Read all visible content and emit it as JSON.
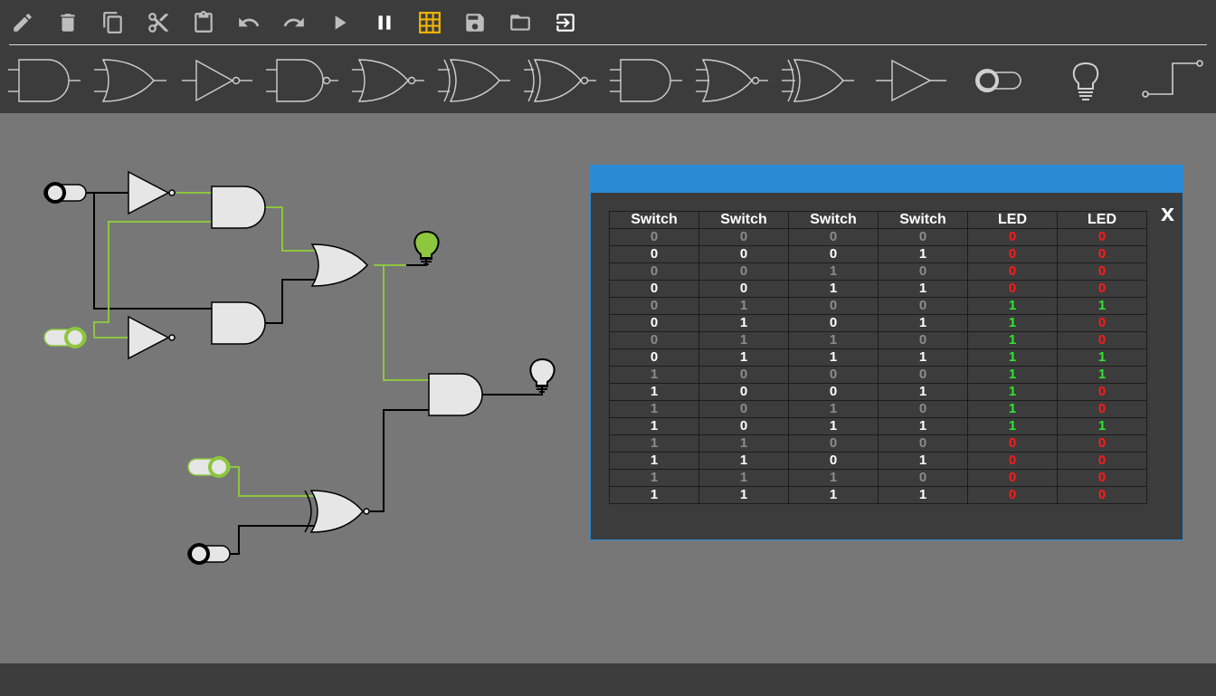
{
  "toolbar": {
    "tools": [
      {
        "name": "edit-icon",
        "active": false
      },
      {
        "name": "delete-icon",
        "active": false
      },
      {
        "name": "copy-icon",
        "active": false
      },
      {
        "name": "cut-icon",
        "active": false
      },
      {
        "name": "paste-icon",
        "active": false
      },
      {
        "name": "undo-icon",
        "active": false
      },
      {
        "name": "redo-icon",
        "active": false
      },
      {
        "name": "play-icon",
        "active": false
      },
      {
        "name": "pause-icon",
        "active": true
      },
      {
        "name": "truth-table-icon",
        "active": true
      },
      {
        "name": "save-icon",
        "active": false
      },
      {
        "name": "open-folder-icon",
        "active": false
      },
      {
        "name": "exit-icon",
        "active": false
      }
    ],
    "components": [
      "and-gate",
      "or-gate",
      "buffer-gate",
      "nand-gate",
      "nor-gate",
      "xor-gate",
      "xnor-gate",
      "and-gate",
      "nor-gate",
      "xnor-gate",
      "buffer-gate",
      "switch",
      "led",
      "clock"
    ]
  },
  "colors": {
    "toolbar_bg": "#3c3c3c",
    "canvas_bg": "#777777",
    "wire_on": "#8dc63f",
    "wire_off": "#000000",
    "dialog_title": "#2a8ad4",
    "value_high": "#2ee82e",
    "value_low": "#ff1a1a",
    "highlight": "#f2b500"
  },
  "truth_table": {
    "close_label": "x",
    "headers": [
      "Switch",
      "Switch",
      "Switch",
      "Switch",
      "LED",
      "LED"
    ],
    "rows": [
      [
        "0",
        "0",
        "0",
        "0",
        "0",
        "0"
      ],
      [
        "0",
        "0",
        "0",
        "1",
        "0",
        "0"
      ],
      [
        "0",
        "0",
        "1",
        "0",
        "0",
        "0"
      ],
      [
        "0",
        "0",
        "1",
        "1",
        "0",
        "0"
      ],
      [
        "0",
        "1",
        "0",
        "0",
        "1",
        "1"
      ],
      [
        "0",
        "1",
        "0",
        "1",
        "1",
        "0"
      ],
      [
        "0",
        "1",
        "1",
        "0",
        "1",
        "0"
      ],
      [
        "0",
        "1",
        "1",
        "1",
        "1",
        "1"
      ],
      [
        "1",
        "0",
        "0",
        "0",
        "1",
        "1"
      ],
      [
        "1",
        "0",
        "0",
        "1",
        "1",
        "0"
      ],
      [
        "1",
        "0",
        "1",
        "0",
        "1",
        "0"
      ],
      [
        "1",
        "0",
        "1",
        "1",
        "1",
        "1"
      ],
      [
        "1",
        "1",
        "0",
        "0",
        "0",
        "0"
      ],
      [
        "1",
        "1",
        "0",
        "1",
        "0",
        "0"
      ],
      [
        "1",
        "1",
        "1",
        "0",
        "0",
        "0"
      ],
      [
        "1",
        "1",
        "1",
        "1",
        "0",
        "0"
      ]
    ]
  }
}
